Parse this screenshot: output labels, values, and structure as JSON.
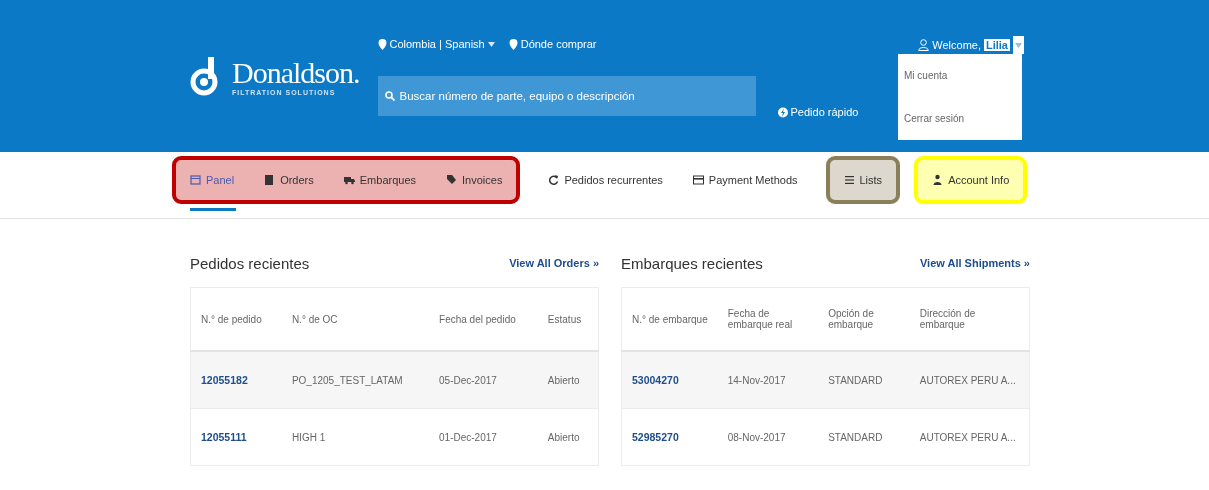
{
  "header": {
    "logo": {
      "name": "Donaldson.",
      "tagline": "FILTRATION SOLUTIONS"
    },
    "locale": "Colombia | Spanish",
    "where_to_buy": "Dónde comprar",
    "search": {
      "placeholder": "Buscar número de parte, equipo o descripción"
    },
    "quick_order": "Pedido rápido",
    "welcome": {
      "label": "Welcome,",
      "user": "Lilia",
      "expanded": true
    },
    "user_menu": [
      "Mi cuenta",
      "Cerrar sesión"
    ]
  },
  "nav": [
    {
      "color": "#c00000",
      "items": [
        {
          "label": "Panel",
          "selected": true
        },
        {
          "label": "Orders",
          "selected": false
        },
        {
          "label": "Embarques",
          "selected": false
        },
        {
          "label": "Invoices",
          "selected": false
        }
      ]
    },
    {
      "items": [
        {
          "label": "Pedidos recurrentes",
          "selected": false
        },
        {
          "label": "Payment Methods",
          "selected": false
        }
      ]
    },
    {
      "color": "#8b7f5a",
      "items": [
        {
          "label": "Lists",
          "selected": false
        }
      ]
    },
    {
      "color": "#ffff00",
      "items": [
        {
          "label": "Account Info",
          "selected": false
        }
      ]
    }
  ],
  "sections": [
    {
      "title": "Pedidos recientes",
      "link": "View All Orders »",
      "columns": [
        "N.° de pedido",
        "N.° de OC",
        "Fecha del pedido",
        "Estatus"
      ],
      "rows": [
        [
          "12055182",
          "PO_1205_TEST_LATAM",
          "05-Dec-2017",
          "Abierto"
        ],
        [
          "12055111",
          "HIGH 1",
          "01-Dec-2017",
          "Abierto"
        ]
      ]
    },
    {
      "title": "Embarques recientes",
      "link": "View All Shipments »",
      "columns": [
        "N.° de embarque",
        "Fecha de embarque real",
        "Opción de embarque",
        "Dirección de embarque"
      ],
      "rows": [
        [
          "53004270",
          "14-Nov-2017",
          "STANDARD",
          "AUTOREX PERU A..."
        ],
        [
          "52985270",
          "08-Nov-2017",
          "STANDARD",
          "AUTOREX PERU A..."
        ]
      ]
    }
  ]
}
